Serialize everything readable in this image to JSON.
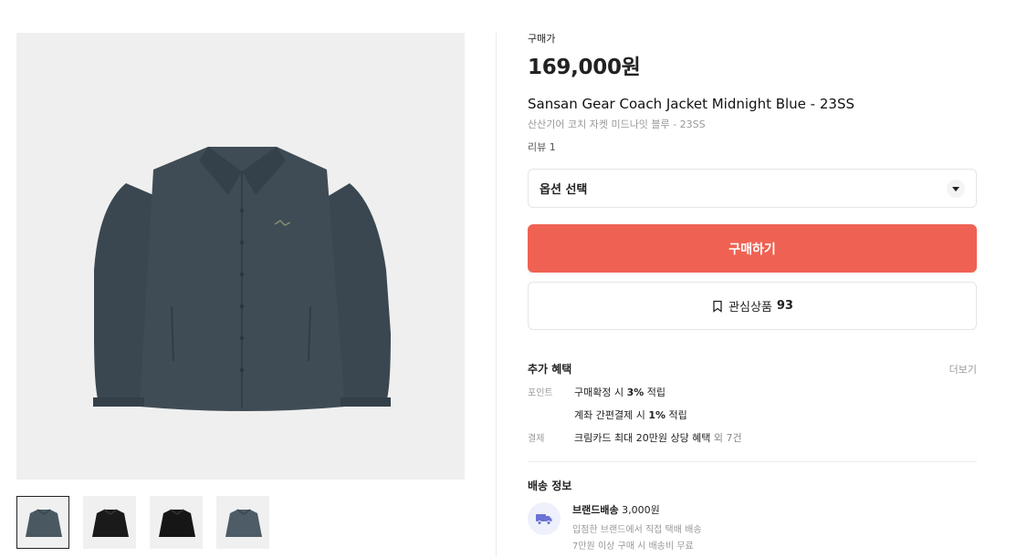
{
  "product": {
    "price_label": "구매가",
    "price": "169,000원",
    "name_en": "Sansan Gear Coach Jacket Midnight Blue - 23SS",
    "name_ko": "산산기어 코치 자켓 미드나잇 블루 - 23SS",
    "reviews": "리뷰 1"
  },
  "gallery": {
    "main_color": "#3f4c55",
    "thumbnails": [
      {
        "color": "#4a5862",
        "selected": true
      },
      {
        "color": "#1a1a1a",
        "selected": false
      },
      {
        "color": "#161616",
        "selected": false
      },
      {
        "color": "#4d5c66",
        "selected": false
      }
    ]
  },
  "option": {
    "label": "옵션 선택"
  },
  "actions": {
    "buy_label": "구매하기",
    "buy_color": "#ef6253",
    "wish_label": "관심상품",
    "wish_count": "93"
  },
  "benefits": {
    "title": "추가 혜택",
    "more": "더보기",
    "point_key": "포인트",
    "point_line1_pre": "구매확정 시 ",
    "point_line1_bold": "3%",
    "point_line1_post": " 적립",
    "point_line2_pre": "계좌 간편결제 시 ",
    "point_line2_bold": "1%",
    "point_line2_post": " 적립",
    "pay_key": "결제",
    "pay_line": "크림카드 최대 20만원 상당 혜택",
    "pay_extra": " 외 7건"
  },
  "shipping": {
    "title": "배송 정보",
    "method": "브랜드배송",
    "fee": " 3,000원",
    "line1": "입점한 브랜드에서 직접 택배 배송",
    "line2": "7만원 이상 구매 시 배송비 무료",
    "icon_color": "#6b72d6"
  }
}
